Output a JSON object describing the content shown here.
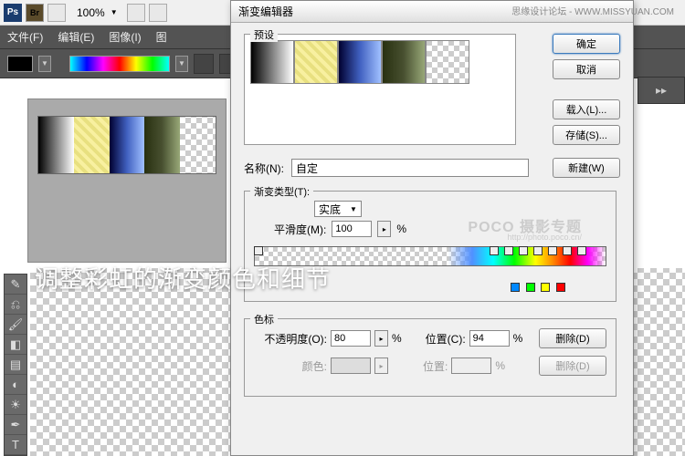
{
  "watermark": {
    "top": "思缘设计论坛 - WWW.MISSYUAN.COM",
    "poco": "POCO 摄影专题",
    "poco_url": "http://photo.poco.cn/"
  },
  "appbar": {
    "zoom": "100%",
    "ps": "Ps",
    "br": "Br"
  },
  "menu": {
    "file": "文件(F)",
    "edit": "编辑(E)",
    "image": "图像(I)",
    "layer_short": "图"
  },
  "dialog": {
    "title": "渐变编辑器",
    "preset_label": "预设",
    "buttons": {
      "ok": "确定",
      "cancel": "取消",
      "load": "载入(L)...",
      "save": "存储(S)...",
      "new": "新建(W)",
      "delete": "删除(D)"
    },
    "name_label": "名称(N):",
    "name_value": "自定",
    "type_label": "渐变类型(T):",
    "type_value": "实底",
    "smooth_label": "平滑度(M):",
    "smooth_value": "100",
    "percent": "%",
    "colorstop_label": "色标",
    "opacity_label": "不透明度(O):",
    "opacity_value": "80",
    "position_label": "位置(C):",
    "position_value": "94",
    "color_label": "颜色:",
    "position2_label": "位置:"
  },
  "overlay": "调整彩虹的渐变颜色和细节"
}
